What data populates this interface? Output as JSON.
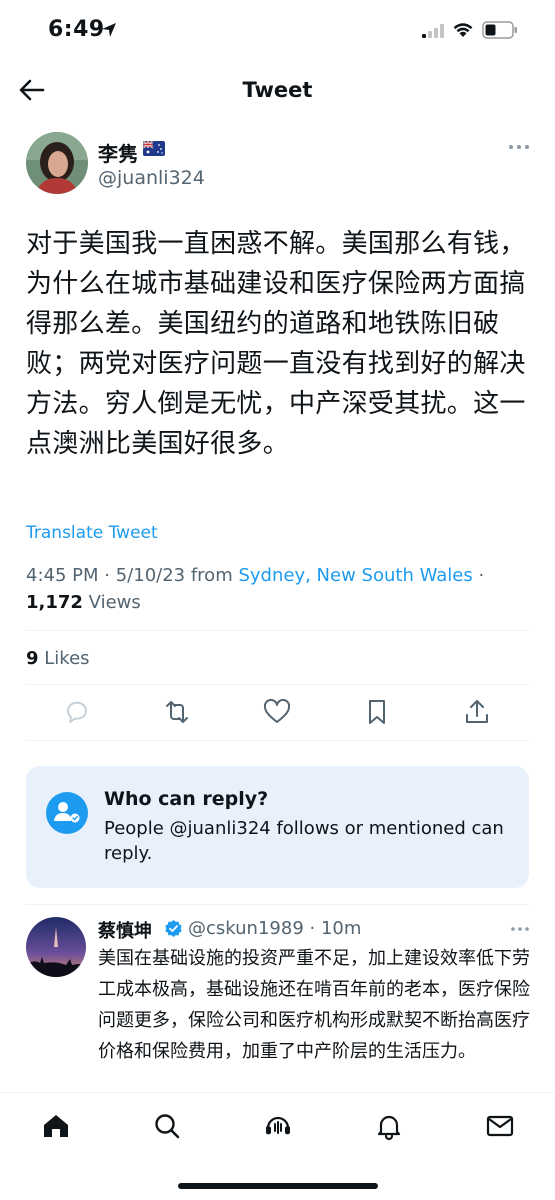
{
  "status_bar": {
    "time": "6:49"
  },
  "nav": {
    "title": "Tweet"
  },
  "author": {
    "name": "李隽",
    "handle": "@juanli324"
  },
  "tweet": {
    "text": "对于美国我一直困惑不解。美国那么有钱，为什么在城市基础建设和医疗保险两方面搞得那么差。美国纽约的道路和地铁陈旧破败；两党对医疗问题一直没有找到好的解决方法。穷人倒是无忧，中产深受其扰。这一点澳洲比美国好很多。",
    "translate_label": "Translate Tweet",
    "time": "4:45 PM",
    "date": "5/10/23",
    "from_label": "from",
    "location": "Sydney, New South Wales",
    "views_count": "1,172",
    "views_label": "Views",
    "likes_count": "9",
    "likes_label": "Likes"
  },
  "who_can_reply": {
    "title": "Who can reply?",
    "description": "People @juanli324 follows or mentioned can reply."
  },
  "reply": {
    "name": "蔡慎坤",
    "handle": "@cskun1989",
    "time": "10m",
    "text": "美国在基础设施的投资严重不足，加上建设效率低下劳工成本极高，基础设施还在啃百年前的老本，医疗保险问题更多，保险公司和医疗机构形成默契不断抬高医疗价格和保险费用，加重了中产阶层的生活压力。"
  },
  "icons": {
    "back": "arrow-left-icon",
    "flag": "australia-flag-icon",
    "more": "more-horizontal-icon",
    "actions": [
      "reply-icon",
      "retweet-icon",
      "like-icon",
      "bookmark-icon",
      "share-icon"
    ],
    "tabs": [
      "home-icon",
      "search-icon",
      "spaces-icon",
      "notifications-icon",
      "messages-icon"
    ]
  },
  "colors": {
    "accent": "#1d9bf0",
    "secondary_text": "#536471",
    "card_bg": "#e8f1fb"
  }
}
